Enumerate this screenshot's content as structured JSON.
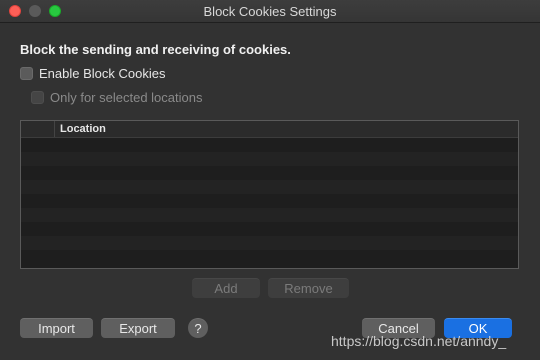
{
  "window": {
    "title": "Block Cookies Settings"
  },
  "heading": "Block the sending and receiving of cookies.",
  "options": {
    "enable_label": "Enable Block Cookies",
    "enable_checked": false,
    "selected_only_label": "Only for selected locations",
    "selected_only_checked": false,
    "selected_only_enabled": false
  },
  "table": {
    "columns": [
      "",
      "Location"
    ],
    "rows": []
  },
  "buttons": {
    "add": "Add",
    "remove": "Remove",
    "import": "Import",
    "export": "Export",
    "help": "?",
    "cancel": "Cancel",
    "ok": "OK"
  },
  "watermark": "https://blog.csdn.net/anndy_",
  "colors": {
    "accent": "#1a70e2",
    "close": "#fe5f57",
    "maximize": "#28c940"
  }
}
